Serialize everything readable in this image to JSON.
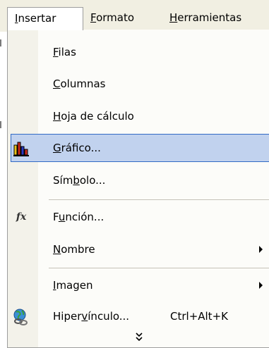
{
  "menubar": {
    "items": [
      {
        "label": "Insertar",
        "mnemonic": "I"
      },
      {
        "label": "Formato",
        "mnemonic": "F"
      },
      {
        "label": "Herramientas",
        "mnemonic": "H"
      }
    ]
  },
  "dropdown": {
    "items": [
      {
        "label": "Filas",
        "icon": null
      },
      {
        "label": "Columnas",
        "icon": null
      },
      {
        "label": "Hoja de cálculo",
        "icon": null
      },
      {
        "label": "Gráfico...",
        "icon": "chart-icon",
        "highlighted": true
      },
      {
        "label": "Símbolo...",
        "icon": null
      },
      {
        "label": "Función...",
        "icon": "function-icon",
        "icon_text": "fx"
      },
      {
        "label": "Nombre",
        "icon": null,
        "submenu": true
      },
      {
        "label": "Imagen",
        "icon": null,
        "submenu": true
      },
      {
        "label": "Hipervínculo...",
        "icon": "hyperlink-globe-icon",
        "shortcut": "Ctrl+Alt+K"
      }
    ],
    "expand_glyph": "⌄⌄"
  },
  "colors": {
    "highlight_fill": "#c1d2ee",
    "highlight_border": "#316ac5",
    "menubar_bg": "#f1efe2",
    "icon_strip_bg": "#f3f2ea"
  }
}
